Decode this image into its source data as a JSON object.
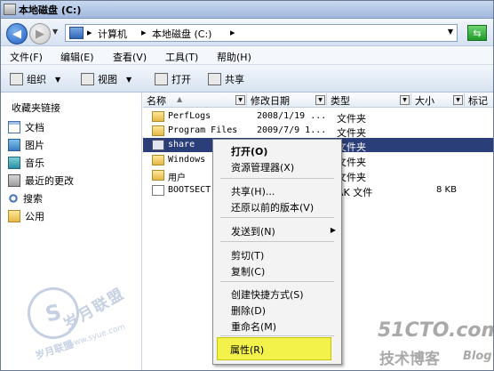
{
  "window": {
    "title": "本地磁盘 (C:)"
  },
  "address": {
    "crumbs": [
      "计算机",
      "本地磁盘 (C:)"
    ],
    "separator": "▸"
  },
  "menu": [
    "文件(F)",
    "编辑(E)",
    "查看(V)",
    "工具(T)",
    "帮助(H)"
  ],
  "toolbar": {
    "organize": "组织",
    "views": "视图",
    "open": "打开",
    "share": "共享"
  },
  "favorites": {
    "title": "收藏夹链接",
    "items": [
      "文档",
      "图片",
      "音乐",
      "最近的更改",
      "搜索",
      "公用"
    ]
  },
  "columns": [
    "名称",
    "修改日期",
    "类型",
    "大小",
    "标记"
  ],
  "files": [
    {
      "name": "PerfLogs",
      "date": "2008/1/19 ...",
      "type": "文件夹",
      "size": ""
    },
    {
      "name": "Program Files",
      "date": "2009/7/9 1...",
      "type": "文件夹",
      "size": ""
    },
    {
      "name": "share",
      "date": "",
      "type": "文件夹",
      "size": ""
    },
    {
      "name": "Windows",
      "date": "",
      "type": "文件夹",
      "size": ""
    },
    {
      "name": "用户",
      "date": "",
      "type": "文件夹",
      "size": ""
    },
    {
      "name": "BOOTSECT.",
      "date": "",
      "type": "AK 文件",
      "size": "8 KB"
    }
  ],
  "context_menu": [
    "打开(O)",
    "资源管理器(X)",
    "共享(H)...",
    "还原以前的版本(V)",
    "发送到(N)",
    "剪切(T)",
    "复制(C)",
    "创建快捷方式(S)",
    "删除(D)",
    "重命名(M)",
    "属性(R)"
  ],
  "watermarks": {
    "left_logo": "S",
    "left_text": "岁月联盟",
    "left_text2": "岁月联盟",
    "left_url": "www.syue.com",
    "brand": "51CTO.com",
    "blog_cn": "技术博客",
    "blog_en": "Blog"
  }
}
